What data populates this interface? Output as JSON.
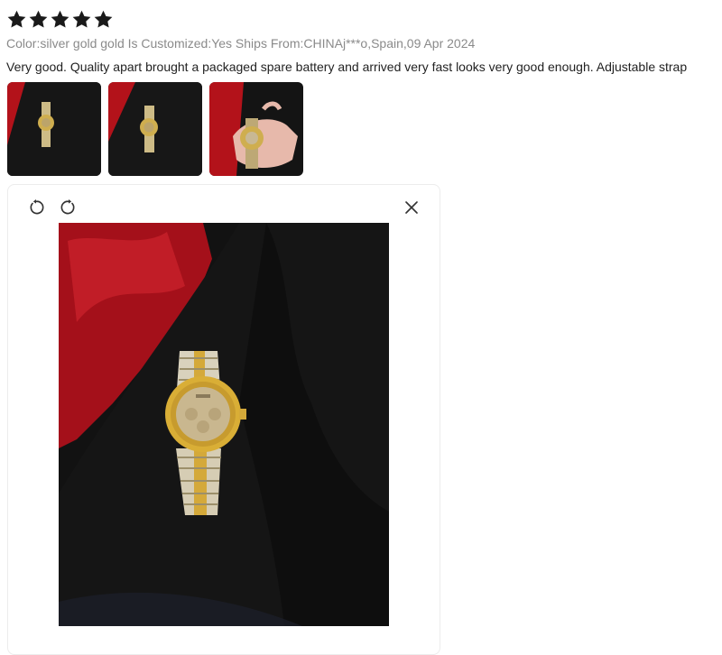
{
  "review": {
    "rating": 5,
    "rating_max": 5,
    "star_color": "#1a1a1a",
    "meta_line": "Color:silver gold gold Is Customized:Yes Ships From:CHINAj***o,Spain,09 Apr 2024",
    "text": "Very good. Quality apart brought a packaged spare battery and arrived very fast looks very good enough. Adjustable strap"
  },
  "thumbnails": [
    {
      "name": "photo-1"
    },
    {
      "name": "photo-2"
    },
    {
      "name": "photo-3"
    }
  ],
  "viewer": {
    "rotate_left_icon": "rotate-left-icon",
    "rotate_right_icon": "rotate-right-icon",
    "close_icon": "close-icon"
  }
}
